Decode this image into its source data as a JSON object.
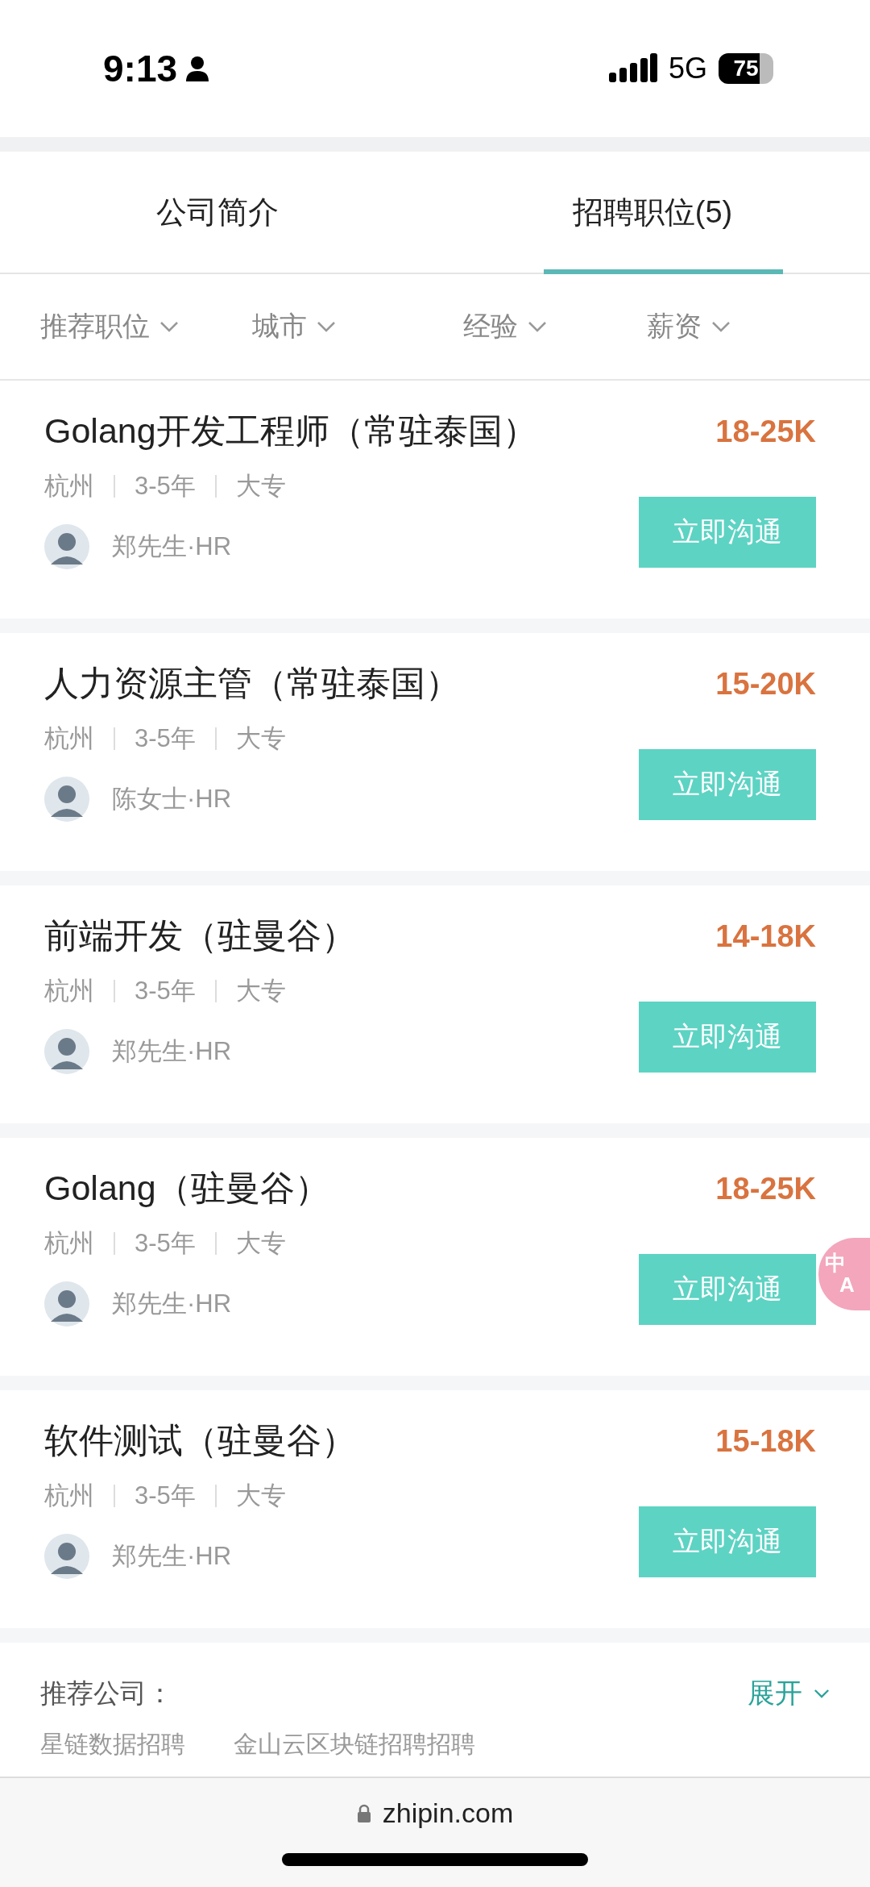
{
  "status_bar": {
    "time": "9:13",
    "network": "5G",
    "battery": "75"
  },
  "tabs": [
    {
      "label": "公司简介",
      "selected": false
    },
    {
      "label": "招聘职位(5)",
      "selected": true
    }
  ],
  "filters": [
    "推荐职位",
    "城市",
    "经验",
    "薪资"
  ],
  "jobs": [
    {
      "title": "Golang开发工程师（常驻泰国）",
      "salary": "18-25K",
      "city": "杭州",
      "experience": "3-5年",
      "education": "大专",
      "recruiter": "郑先生·HR",
      "button": "立即沟通"
    },
    {
      "title": "人力资源主管（常驻泰国）",
      "salary": "15-20K",
      "city": "杭州",
      "experience": "3-5年",
      "education": "大专",
      "recruiter": "陈女士·HR",
      "button": "立即沟通"
    },
    {
      "title": "前端开发（驻曼谷）",
      "salary": "14-18K",
      "city": "杭州",
      "experience": "3-5年",
      "education": "大专",
      "recruiter": "郑先生·HR",
      "button": "立即沟通"
    },
    {
      "title": "Golang（驻曼谷）",
      "salary": "18-25K",
      "city": "杭州",
      "experience": "3-5年",
      "education": "大专",
      "recruiter": "郑先生·HR",
      "button": "立即沟通"
    },
    {
      "title": "软件测试（驻曼谷）",
      "salary": "15-18K",
      "city": "杭州",
      "experience": "3-5年",
      "education": "大专",
      "recruiter": "郑先生·HR",
      "button": "立即沟通"
    }
  ],
  "translate_badge": {
    "top": "中",
    "bottom": "A"
  },
  "recommended": {
    "label": "推荐公司：",
    "expand": "展开",
    "companies": [
      "星链数据招聘",
      "金山云区块链招聘招聘"
    ]
  },
  "browser_bar": {
    "url": "zhipin.com"
  }
}
